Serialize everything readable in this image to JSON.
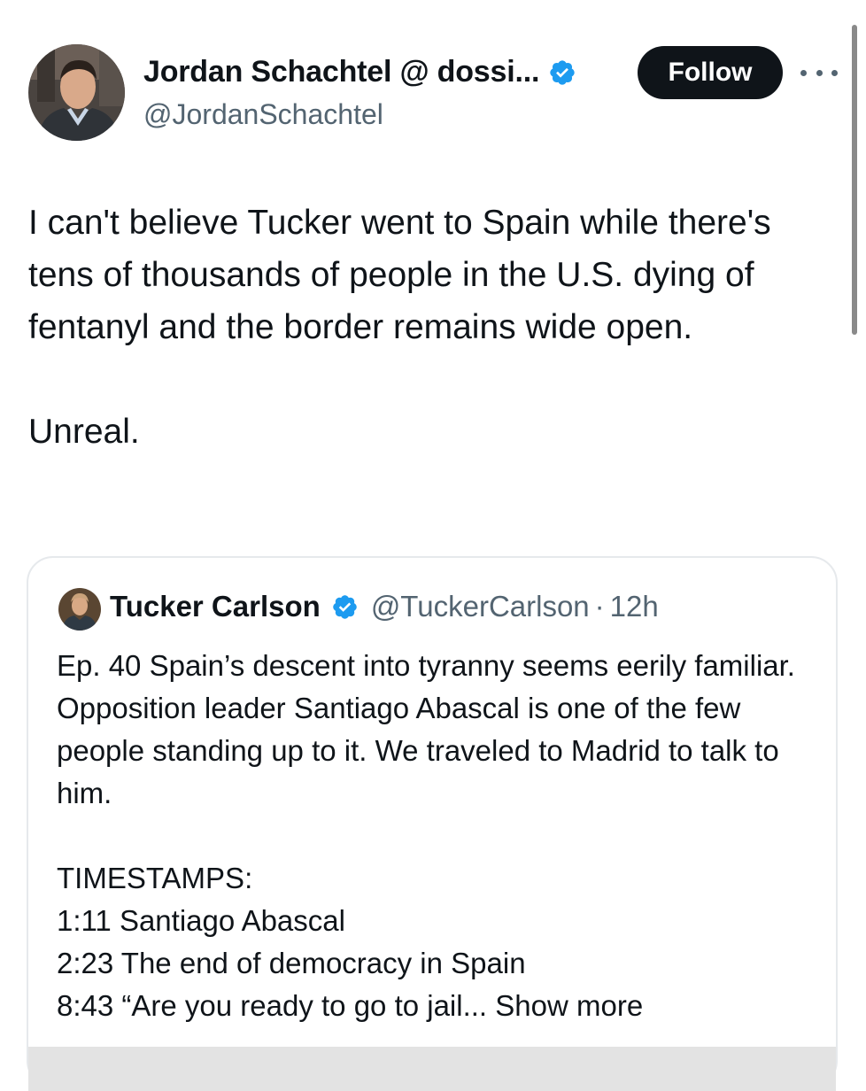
{
  "author": {
    "display_name": "Jordan Schachtel @ dossi...",
    "handle": "@JordanSchachtel",
    "avatar_icon": "profile-photo"
  },
  "actions": {
    "follow_label": "Follow",
    "more_icon": "more-horizontal-icon"
  },
  "post": {
    "paragraph_1": "I can't believe Tucker went to Spain while there's tens of thousands of people in the U.S. dying of fentanyl and the border remains wide open.",
    "paragraph_2": "Unreal."
  },
  "quote": {
    "display_name": "Tucker Carlson",
    "handle": "@TuckerCarlson",
    "separator": "·",
    "time": "12h",
    "paragraph_1": "Ep. 40  Spain’s descent into tyranny seems eerily familiar. Opposition leader Santiago Abascal is one of the few people standing up to it. We traveled to Madrid to talk to him.",
    "timestamps_heading": "TIMESTAMPS:",
    "timestamps": [
      "1:11 Santiago Abascal",
      "2:23 The end of democracy in Spain"
    ],
    "last_line": "8:43 “Are you ready to go to jail...",
    "show_more_label": "Show more"
  },
  "colors": {
    "verified_blue": "#1d9bf0",
    "text_primary": "#0f1419",
    "text_secondary": "#536471",
    "follow_bg": "#0f1419",
    "card_border": "#e6e9ec"
  }
}
